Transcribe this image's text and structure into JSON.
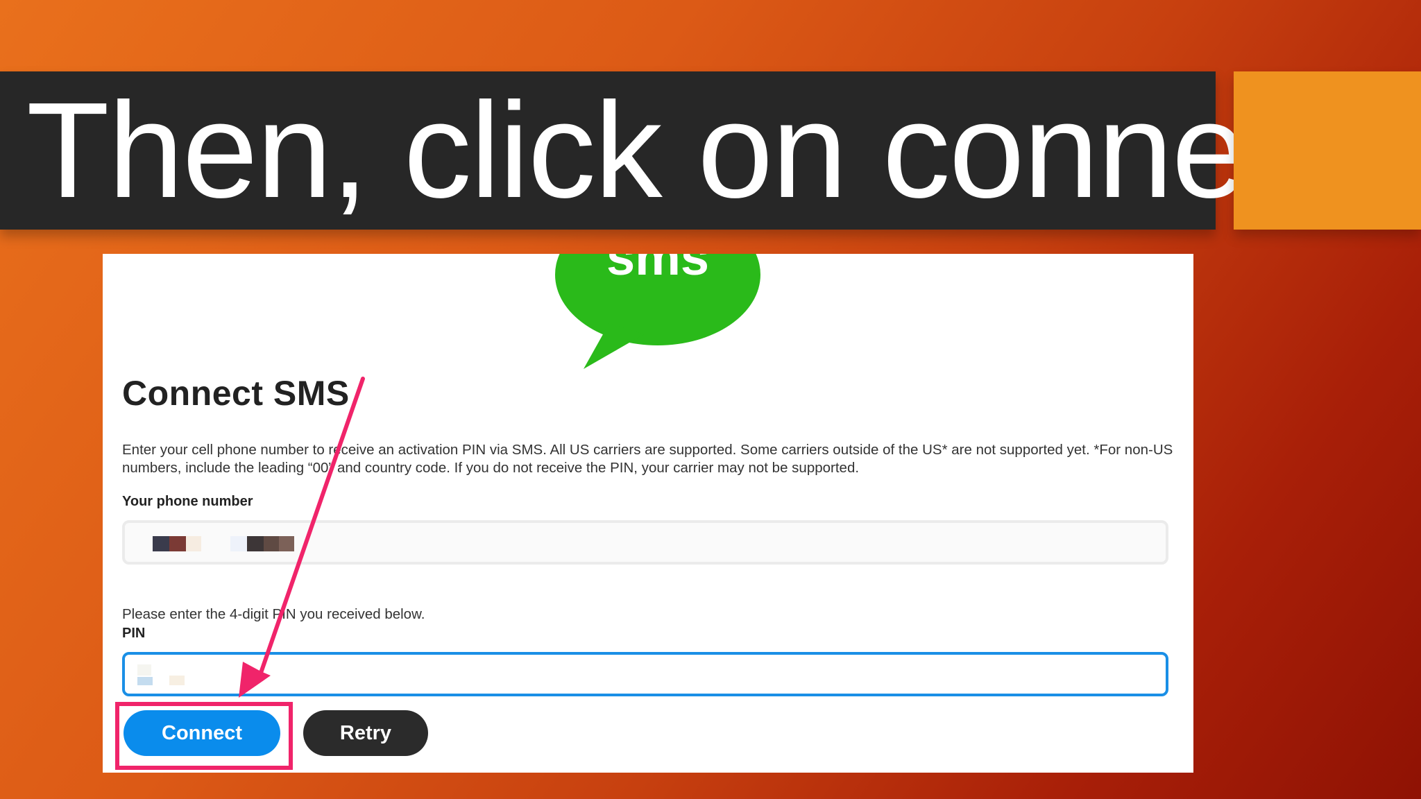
{
  "slide": {
    "title": "Then, click on connect"
  },
  "colors": {
    "banner": "#272727",
    "accent": "#ef921f",
    "sms_green": "#2aba1a",
    "connect_blue": "#0a8cec",
    "retry_dark": "#2b2b2b",
    "highlight_pink": "#f0246a",
    "focus_blue": "#1a8fe6"
  },
  "screenshot": {
    "logo_text": "sms",
    "heading": "Connect SMS",
    "description": "Enter your cell phone number to receive an activation PIN via SMS. All US carriers are supported. Some carriers outside of the US* are not supported yet. *For non-US numbers, include the leading “00” and country code. If you do not receive the PIN, your carrier may not be supported.",
    "phone_label": "Your phone number",
    "pin_instructions": "Please enter the 4-digit PIN you received below.",
    "pin_label": "PIN",
    "connect_button": "Connect",
    "retry_button": "Retry"
  },
  "icons": {
    "logo": "sms-speech-bubble-icon",
    "annotation": "pointer-arrow-icon"
  }
}
